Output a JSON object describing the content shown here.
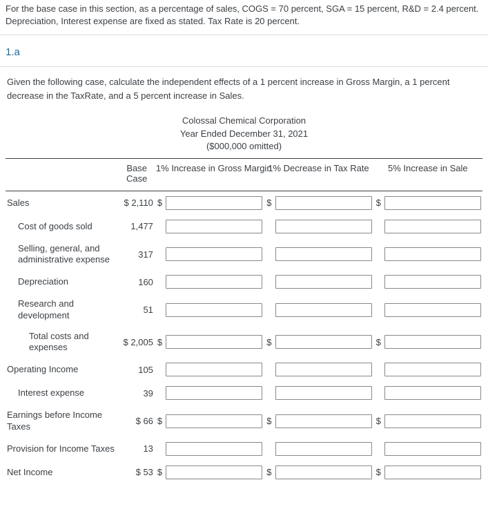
{
  "preamble": "For the base case in this section, as a percentage of sales, COGS = 70 percent, SGA = 15 percent, R&D = 2.4 percent. Depreciation, Interest expense are fixed as stated. Tax Rate is 20 percent.",
  "section_tag": "1.a",
  "prompt": "Given the following case, calculate the independent effects of a 1 percent increase in Gross Margin, a 1 percent decrease in the TaxRate, and a 5 percent increase in Sales.",
  "title": {
    "line1": "Colossal Chemical Corporation",
    "line2": "Year Ended December 31, 2021",
    "line3": "($000,000 omitted)"
  },
  "columns": {
    "base": "Base Case",
    "c1": "1% Increase in Gross Margin",
    "c2": "1% Decrease in Tax Rate",
    "c3": "5% Increase in Sale"
  },
  "dollar": "$",
  "rows": {
    "sales": {
      "label": "Sales",
      "base": "$ 2,110",
      "dollar": true
    },
    "cogs": {
      "label": "Cost of goods sold",
      "base": "1,477",
      "dollar": false
    },
    "sga": {
      "label": "Selling, general, and administrative expense",
      "base": "317",
      "dollar": false
    },
    "dep": {
      "label": "Depreciation",
      "base": "160",
      "dollar": false
    },
    "rnd": {
      "label": "Research and development",
      "base": "51",
      "dollar": false
    },
    "total": {
      "label": "Total costs and expenses",
      "base": "$ 2,005",
      "dollar": true
    },
    "opinc": {
      "label": "Operating Income",
      "base": "105",
      "dollar": false
    },
    "intexp": {
      "label": "Interest expense",
      "base": "39",
      "dollar": false
    },
    "ebt": {
      "label": "Earnings before Income Taxes",
      "base": "$ 66",
      "dollar": true
    },
    "tax": {
      "label": "Provision for Income Taxes",
      "base": "13",
      "dollar": false
    },
    "net": {
      "label": "Net Income",
      "base": "$ 53",
      "dollar": true
    }
  }
}
